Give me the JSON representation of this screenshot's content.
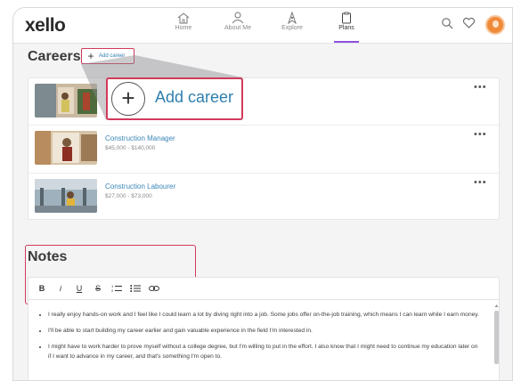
{
  "app": {
    "logo": "xello"
  },
  "nav": [
    {
      "label": "Home",
      "icon": "home-icon"
    },
    {
      "label": "About Me",
      "icon": "person-icon"
    },
    {
      "label": "Explore",
      "icon": "compass-icon"
    },
    {
      "label": "Plans",
      "icon": "clipboard-icon",
      "active": true
    }
  ],
  "header_icons": [
    "search-icon",
    "heart-icon",
    "avatar"
  ],
  "careers": {
    "title": "Careers",
    "add_label": "Add career",
    "zoom_add_label": "Add career",
    "items": [
      {
        "title": "",
        "salary": ""
      },
      {
        "title": "Construction Manager",
        "salary": "$45,000 - $140,000"
      },
      {
        "title": "Construction Labourer",
        "salary": "$27,000 - $73,000"
      }
    ],
    "menu_glyph": "•••"
  },
  "notes": {
    "title": "Notes",
    "toolbar": [
      "B",
      "i",
      "U",
      "S",
      "numbered-list",
      "bullet-list",
      "link"
    ],
    "bullets": [
      "I really enjoy hands-on work and I feel like I could learn a lot by diving right into a job. Some jobs offer on-the-job training, which means I can learn while I earn money.",
      "I'll be able to start building my career earlier and gain valuable experience in the field I'm interested in.",
      "I might have to work harder to prove myself without a college degree, but I'm willing to put in the effort. I also know that I might need to continue my education later on if I want to advance in my career, and that's something I'm open to."
    ]
  },
  "colors": {
    "accent": "#8e4fe0",
    "link": "#2f7fae",
    "highlight": "#d23a5a"
  }
}
